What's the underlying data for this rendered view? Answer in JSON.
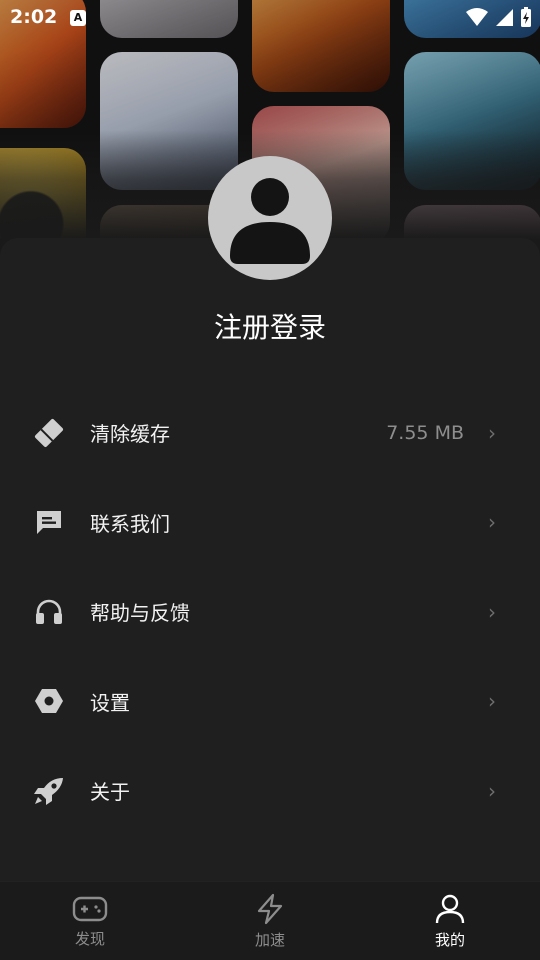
{
  "status_bar": {
    "time": "2:02",
    "notification_badge": "A"
  },
  "profile": {
    "login_label": "注册登录"
  },
  "menu": [
    {
      "label": "清除缓存",
      "value": "7.55 MB",
      "icon": "tag-eraser-icon"
    },
    {
      "label": "联系我们",
      "value": "",
      "icon": "chat-bubble-icon"
    },
    {
      "label": "帮助与反馈",
      "value": "",
      "icon": "headphones-icon"
    },
    {
      "label": "设置",
      "value": "",
      "icon": "hexagon-settings-icon"
    },
    {
      "label": "关于",
      "value": "",
      "icon": "rocket-icon"
    }
  ],
  "arrow_glyph": "›",
  "bottom_nav": [
    {
      "label": "发现",
      "icon": "gamepad-icon",
      "active": false
    },
    {
      "label": "加速",
      "icon": "lightning-icon",
      "active": false
    },
    {
      "label": "我的",
      "icon": "user-icon",
      "active": true
    }
  ],
  "colors": {
    "background": "#1a1a1a",
    "text": "#ffffff",
    "muted": "#8e8e8e",
    "avatar": "#c8c8c8"
  }
}
